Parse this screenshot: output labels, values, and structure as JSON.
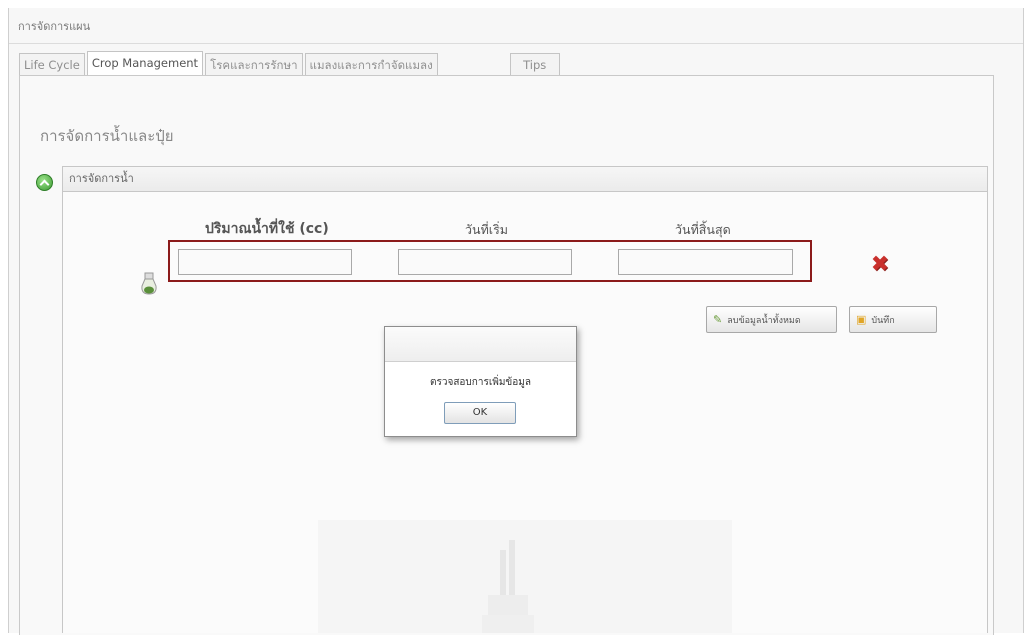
{
  "window": {
    "title": "การจัดการแผน"
  },
  "tabs": [
    {
      "label": "Life Cycle"
    },
    {
      "label": "Crop Management"
    },
    {
      "label": "โรคและการรักษา"
    },
    {
      "label": "แมลงและการกำจัดแมลง"
    },
    {
      "label": "Tips"
    }
  ],
  "section": {
    "title": "การจัดการน้ำและปุ๋ย"
  },
  "water_panel": {
    "header": "การจัดการน้ำ",
    "columns": {
      "amount": "ปริมาณน้ำที่ใช้ (cc)",
      "start_date": "วันที่เริ่ม",
      "end_date": "วันที่สิ้นสุด"
    },
    "fields": {
      "amount": "",
      "start_date": "",
      "end_date": ""
    }
  },
  "buttons": {
    "delete_all": "ลบข้อมูลน้ำทั้งหมด",
    "save": "บันทึก"
  },
  "dialog": {
    "message": "ตรวจสอบการเพิ่มข้อมูล",
    "ok_label": "OK"
  },
  "colors": {
    "highlight_frame": "#8b1a1a",
    "remove_icon": "#c9302c",
    "collapse_icon": "#3d9a33"
  },
  "icons": {
    "collapse": "collapse-toggle-icon",
    "remove": "remove-x-icon",
    "add_row": "flask-icon",
    "delete_all": "broom-icon",
    "save": "floppy-disk-icon"
  }
}
